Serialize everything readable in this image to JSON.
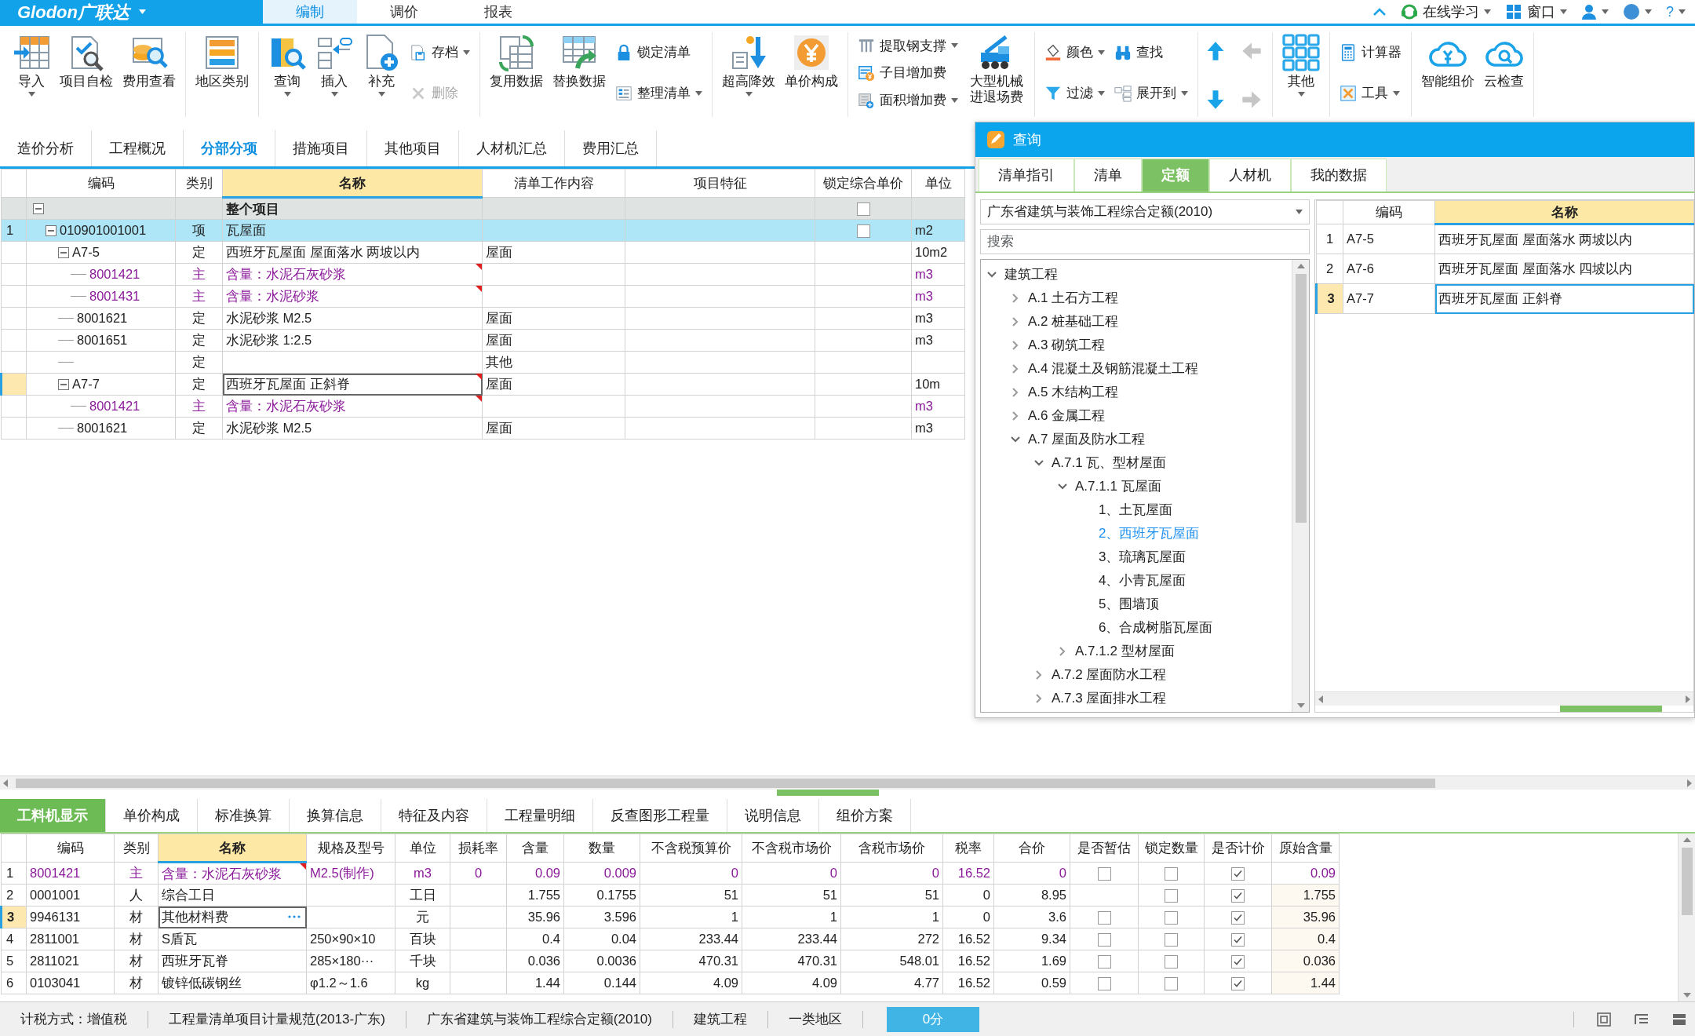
{
  "top_bar": {
    "logo": "Glodon广联达",
    "menu_tabs": [
      {
        "label": "编制",
        "selected": true
      },
      {
        "label": "调价",
        "selected": false
      },
      {
        "label": "报表",
        "selected": false
      }
    ],
    "links": [
      "在线学习",
      "窗口"
    ],
    "help": "?"
  },
  "ribbon": {
    "groups": [
      {
        "items": [
          {
            "kind": "large",
            "label": "导入",
            "dropdown": true,
            "disabled": false
          },
          {
            "kind": "large",
            "label": "项目自检",
            "dropdown": false,
            "disabled": false
          },
          {
            "kind": "large",
            "label": "费用查看",
            "dropdown": false,
            "disabled": false
          }
        ]
      },
      {
        "items": [
          {
            "kind": "large",
            "label": "地区类别",
            "dropdown": false,
            "disabled": false
          }
        ]
      },
      {
        "items": [
          {
            "kind": "large",
            "label": "查询",
            "dropdown": true,
            "disabled": false
          },
          {
            "kind": "large",
            "label": "插入",
            "dropdown": true,
            "disabled": false
          },
          {
            "kind": "large",
            "label": "补充",
            "dropdown": true,
            "disabled": false
          },
          {
            "kind": "small",
            "label": "存档",
            "dropdown": true,
            "disabled": false
          },
          {
            "kind": "small",
            "label": "删除",
            "dropdown": false,
            "disabled": true
          }
        ]
      },
      {
        "items": [
          {
            "kind": "large",
            "label": "复用数据",
            "dropdown": false,
            "disabled": false
          },
          {
            "kind": "large",
            "label": "替换数据",
            "dropdown": false,
            "disabled": false
          },
          {
            "kind": "small",
            "label": "锁定清单",
            "dropdown": false,
            "disabled": false
          },
          {
            "kind": "small",
            "label": "整理清单",
            "dropdown": true,
            "disabled": false
          }
        ]
      },
      {
        "items": [
          {
            "kind": "large",
            "label": "超高降效",
            "dropdown": true,
            "disabled": false
          },
          {
            "kind": "large",
            "label": "单价构成",
            "dropdown": false,
            "disabled": false
          }
        ]
      },
      {
        "items": [
          {
            "kind": "small",
            "label": "提取钢支撑",
            "dropdown": true,
            "disabled": false
          },
          {
            "kind": "small",
            "label": "子目增加费",
            "dropdown": false,
            "disabled": false
          },
          {
            "kind": "small",
            "label": "面积增加费",
            "dropdown": true,
            "disabled": false
          },
          {
            "kind": "large",
            "label": "大型机械进退场费",
            "dropdown": false,
            "disabled": false
          }
        ]
      },
      {
        "items": [
          {
            "kind": "small",
            "label": "颜色",
            "dropdown": true,
            "disabled": false
          },
          {
            "kind": "small",
            "label": "过滤",
            "dropdown": true,
            "disabled": false
          },
          {
            "kind": "small",
            "label": "查找",
            "dropdown": false,
            "disabled": false
          },
          {
            "kind": "small",
            "label": "展开到",
            "dropdown": true,
            "disabled": false
          }
        ]
      },
      {
        "items": [
          {
            "kind": "arrow",
            "disabled": false
          },
          {
            "kind": "arrow",
            "disabled": true
          },
          {
            "kind": "arrow",
            "disabled": false
          },
          {
            "kind": "arrow",
            "disabled": true
          }
        ]
      },
      {
        "items": [
          {
            "kind": "large",
            "label": "其他",
            "dropdown": true,
            "disabled": false
          }
        ]
      },
      {
        "items": [
          {
            "kind": "small",
            "label": "计算器",
            "dropdown": false,
            "disabled": false
          },
          {
            "kind": "small",
            "label": "工具",
            "dropdown": true,
            "disabled": false
          }
        ]
      },
      {
        "items": [
          {
            "kind": "large",
            "label": "智能组价",
            "dropdown": false,
            "disabled": false
          },
          {
            "kind": "large",
            "label": "云检查",
            "dropdown": false,
            "disabled": false
          }
        ]
      }
    ]
  },
  "view_tabs": [
    {
      "label": "造价分析",
      "selected": false
    },
    {
      "label": "工程概况",
      "selected": false
    },
    {
      "label": "分部分项",
      "selected": true
    },
    {
      "label": "措施项目",
      "selected": false
    },
    {
      "label": "其他项目",
      "selected": false
    },
    {
      "label": "人材机汇总",
      "selected": false
    },
    {
      "label": "费用汇总",
      "selected": false
    }
  ],
  "grid": {
    "columns": [
      {
        "label": "编码",
        "highlighted": false
      },
      {
        "label": "类别",
        "highlighted": false
      },
      {
        "label": "名称",
        "highlighted": true
      },
      {
        "label": "清单工作内容",
        "highlighted": false
      },
      {
        "label": "项目特征",
        "highlighted": false
      },
      {
        "label": "锁定综合单价",
        "highlighted": false
      },
      {
        "label": "单位",
        "highlighted": false
      }
    ],
    "rows": [
      {
        "kind": "group",
        "name": "整个项目",
        "locked": false,
        "expanded": true,
        "selected": false,
        "current": false,
        "marked": false,
        "children": [
          {
            "kind": "normal",
            "number": "1",
            "code": "010901001001",
            "type": "项",
            "name": "瓦屋面",
            "unit": "m2",
            "locked": false,
            "expanded": true,
            "selected": true,
            "current": false,
            "marked": false,
            "children": [
              {
                "kind": "normal",
                "code": "A7-5",
                "type": "定",
                "name": "西班牙瓦屋面 屋面落水 两坡以内",
                "content": "屋面",
                "unit": "10m2",
                "expanded": true,
                "selected": false,
                "current": false,
                "marked": false,
                "children": [
                  {
                    "kind": "main",
                    "code": "8001421",
                    "type": "主",
                    "name": "含量：水泥石灰砂浆",
                    "unit": "m3",
                    "selected": false,
                    "current": false,
                    "marked": true
                  },
                  {
                    "kind": "main",
                    "code": "8001431",
                    "type": "主",
                    "name": "含量：水泥砂浆",
                    "unit": "m3",
                    "selected": false,
                    "current": false,
                    "marked": true
                  }
                ]
              },
              {
                "kind": "normal",
                "code": "8001621",
                "type": "定",
                "name": "水泥砂浆 M2.5",
                "content": "屋面",
                "unit": "m3",
                "selected": false,
                "current": false,
                "marked": false
              },
              {
                "kind": "normal",
                "code": "8001651",
                "type": "定",
                "name": "水泥砂浆 1:2.5",
                "content": "屋面",
                "unit": "m3",
                "selected": false,
                "current": false,
                "marked": false
              },
              {
                "kind": "normal",
                "type": "定",
                "content": "其他",
                "selected": false,
                "current": false,
                "marked": false
              },
              {
                "kind": "normal",
                "code": "A7-7",
                "type": "定",
                "name": "西班牙瓦屋面 正斜脊",
                "content": "屋面",
                "unit": "10m",
                "expanded": true,
                "selected": false,
                "current": true,
                "marked": true,
                "children": [
                  {
                    "kind": "main",
                    "code": "8001421",
                    "type": "主",
                    "name": "含量：水泥石灰砂浆",
                    "unit": "m3",
                    "selected": false,
                    "current": false,
                    "marked": true
                  }
                ]
              },
              {
                "kind": "normal",
                "code": "8001621",
                "type": "定",
                "name": "水泥砂浆 M2.5",
                "content": "屋面",
                "unit": "m3",
                "selected": false,
                "current": false,
                "marked": false
              }
            ]
          }
        ]
      }
    ]
  },
  "query_dialog": {
    "title": "查询",
    "tabs": [
      {
        "label": "清单指引",
        "selected": false
      },
      {
        "label": "清单",
        "selected": false
      },
      {
        "label": "定额",
        "selected": true
      },
      {
        "label": "人材机",
        "selected": false
      },
      {
        "label": "我的数据",
        "selected": false
      }
    ],
    "library": {
      "value": "广东省建筑与装饰工程综合定额(2010)"
    },
    "search": {
      "placeholder": "搜索"
    },
    "tree": [
      {
        "label": "建筑工程",
        "expanded": true,
        "selected": false,
        "children": [
          {
            "label": "A.1 土石方工程",
            "expanded": false,
            "selected": false
          },
          {
            "label": "A.2 桩基础工程",
            "expanded": false,
            "selected": false
          },
          {
            "label": "A.3 砌筑工程",
            "expanded": false,
            "selected": false
          },
          {
            "label": "A.4 混凝土及钢筋混凝土工程",
            "expanded": false,
            "selected": false
          },
          {
            "label": "A.5 木结构工程",
            "expanded": false,
            "selected": false
          },
          {
            "label": "A.6 金属工程",
            "expanded": false,
            "selected": false
          },
          {
            "label": "A.7 屋面及防水工程",
            "expanded": true,
            "selected": false,
            "children": [
              {
                "label": "A.7.1 瓦、型材屋面",
                "expanded": true,
                "selected": false,
                "children": [
                  {
                    "label": "A.7.1.1 瓦屋面",
                    "expanded": true,
                    "selected": false,
                    "children": [
                      {
                        "label": "1、土瓦屋面",
                        "selected": false
                      },
                      {
                        "label": "2、西班牙瓦屋面",
                        "selected": true
                      },
                      {
                        "label": "3、琉璃瓦屋面",
                        "selected": false
                      },
                      {
                        "label": "4、小青瓦屋面",
                        "selected": false
                      },
                      {
                        "label": "5、围墙顶",
                        "selected": false
                      },
                      {
                        "label": "6、合成树脂瓦屋面",
                        "selected": false
                      }
                    ]
                  },
                  {
                    "label": "A.7.1.2 型材屋面",
                    "expanded": false,
                    "selected": false
                  }
                ]
              },
              {
                "label": "A.7.2 屋面防水工程",
                "expanded": false,
                "selected": false
              },
              {
                "label": "A.7.3 屋面排水工程",
                "expanded": false,
                "selected": false
              }
            ]
          }
        ]
      }
    ],
    "results": {
      "columns": [
        {
          "label": "编码",
          "highlighted": false
        },
        {
          "label": "名称",
          "highlighted": true
        }
      ],
      "rows": [
        {
          "number": "1",
          "code": "A7-5",
          "name": "西班牙瓦屋面 屋面落水 两坡以内",
          "selected": false
        },
        {
          "number": "2",
          "code": "A7-6",
          "name": "西班牙瓦屋面 屋面落水 四坡以内",
          "selected": false
        },
        {
          "number": "3",
          "code": "A7-7",
          "name": "西班牙瓦屋面 正斜脊",
          "selected": true
        }
      ]
    }
  },
  "detail_tabs": [
    {
      "label": "工料机显示",
      "selected": true
    },
    {
      "label": "单价构成",
      "selected": false
    },
    {
      "label": "标准换算",
      "selected": false
    },
    {
      "label": "换算信息",
      "selected": false
    },
    {
      "label": "特征及内容",
      "selected": false
    },
    {
      "label": "工程量明细",
      "selected": false
    },
    {
      "label": "反查图形工程量",
      "selected": false
    },
    {
      "label": "说明信息",
      "selected": false
    },
    {
      "label": "组价方案",
      "selected": false
    }
  ],
  "detail_grid": {
    "columns": [
      {
        "label": "编码",
        "highlighted": false
      },
      {
        "label": "类别",
        "highlighted": false
      },
      {
        "label": "名称",
        "highlighted": true
      },
      {
        "label": "规格及型号",
        "highlighted": false
      },
      {
        "label": "单位",
        "highlighted": false
      },
      {
        "label": "损耗率",
        "highlighted": false
      },
      {
        "label": "含量",
        "highlighted": false
      },
      {
        "label": "数量",
        "highlighted": false
      },
      {
        "label": "不含税预算价",
        "highlighted": false
      },
      {
        "label": "不含税市场价",
        "highlighted": false
      },
      {
        "label": "含税市场价",
        "highlighted": false
      },
      {
        "label": "税率",
        "highlighted": false
      },
      {
        "label": "合价",
        "highlighted": false
      },
      {
        "label": "是否暂估",
        "highlighted": false
      },
      {
        "label": "锁定数量",
        "highlighted": false
      },
      {
        "label": "是否计价",
        "highlighted": false
      },
      {
        "label": "原始含量",
        "highlighted": false
      }
    ],
    "rows": [
      {
        "kind": "main",
        "number": "1",
        "code": "8001421",
        "type": "主",
        "name": "含量：水泥石灰砂浆",
        "spec": "M2.5(制作)",
        "unit": "m3",
        "loss": "0",
        "content_qty": "0.09",
        "quantity": "0.009",
        "budget_pretax": "0",
        "market_pretax": "0",
        "market_taxed": "0",
        "tax_rate": "16.52",
        "total": "0",
        "estimate": false,
        "lock_qty": false,
        "priced": true,
        "original_qty": "0.09",
        "current": false,
        "marked": true
      },
      {
        "kind": "normal",
        "number": "2",
        "code": "0001001",
        "type": "人",
        "name": "综合工日",
        "unit": "工日",
        "content_qty": "1.755",
        "quantity": "0.1755",
        "budget_pretax": "51",
        "market_pretax": "51",
        "market_taxed": "51",
        "tax_rate": "0",
        "total": "8.95",
        "lock_qty": false,
        "priced": true,
        "original_qty": "1.755",
        "current": false,
        "marked": false
      },
      {
        "kind": "normal",
        "number": "3",
        "code": "9946131",
        "type": "材",
        "name": "其他材料费",
        "unit": "元",
        "content_qty": "35.96",
        "quantity": "3.596",
        "budget_pretax": "1",
        "market_pretax": "1",
        "market_taxed": "1",
        "tax_rate": "0",
        "total": "3.6",
        "estimate": false,
        "lock_qty": false,
        "priced": true,
        "original_qty": "35.96",
        "current": true,
        "marked": false
      },
      {
        "kind": "normal",
        "number": "4",
        "code": "2811001",
        "type": "材",
        "name": "S盾瓦",
        "spec": "250×90×10",
        "unit": "百块",
        "content_qty": "0.4",
        "quantity": "0.04",
        "budget_pretax": "233.44",
        "market_pretax": "233.44",
        "market_taxed": "272",
        "tax_rate": "16.52",
        "total": "9.34",
        "estimate": false,
        "lock_qty": false,
        "priced": true,
        "original_qty": "0.4",
        "current": false,
        "marked": false
      },
      {
        "kind": "normal",
        "number": "5",
        "code": "2811021",
        "type": "材",
        "name": "西班牙瓦脊",
        "spec": "285×180···",
        "unit": "千块",
        "content_qty": "0.036",
        "quantity": "0.0036",
        "budget_pretax": "470.31",
        "market_pretax": "470.31",
        "market_taxed": "548.01",
        "tax_rate": "16.52",
        "total": "1.69",
        "estimate": false,
        "lock_qty": false,
        "priced": true,
        "original_qty": "0.036",
        "current": false,
        "marked": false
      },
      {
        "kind": "normal",
        "number": "6",
        "code": "0103041",
        "type": "材",
        "name": "镀锌低碳钢丝",
        "spec": "φ1.2～1.6",
        "unit": "kg",
        "content_qty": "1.44",
        "quantity": "0.144",
        "budget_pretax": "4.09",
        "market_pretax": "4.09",
        "market_taxed": "4.77",
        "tax_rate": "16.52",
        "total": "0.59",
        "estimate": false,
        "lock_qty": false,
        "priced": true,
        "original_qty": "1.44",
        "current": false,
        "marked": false
      }
    ]
  },
  "status_bar": {
    "items": [
      "计税方式：增值税",
      "工程量清单项目计量规范(2013-广东)",
      "广东省建筑与装饰工程综合定额(2010)",
      "建筑工程",
      "一类地区"
    ],
    "score": "0分"
  }
}
